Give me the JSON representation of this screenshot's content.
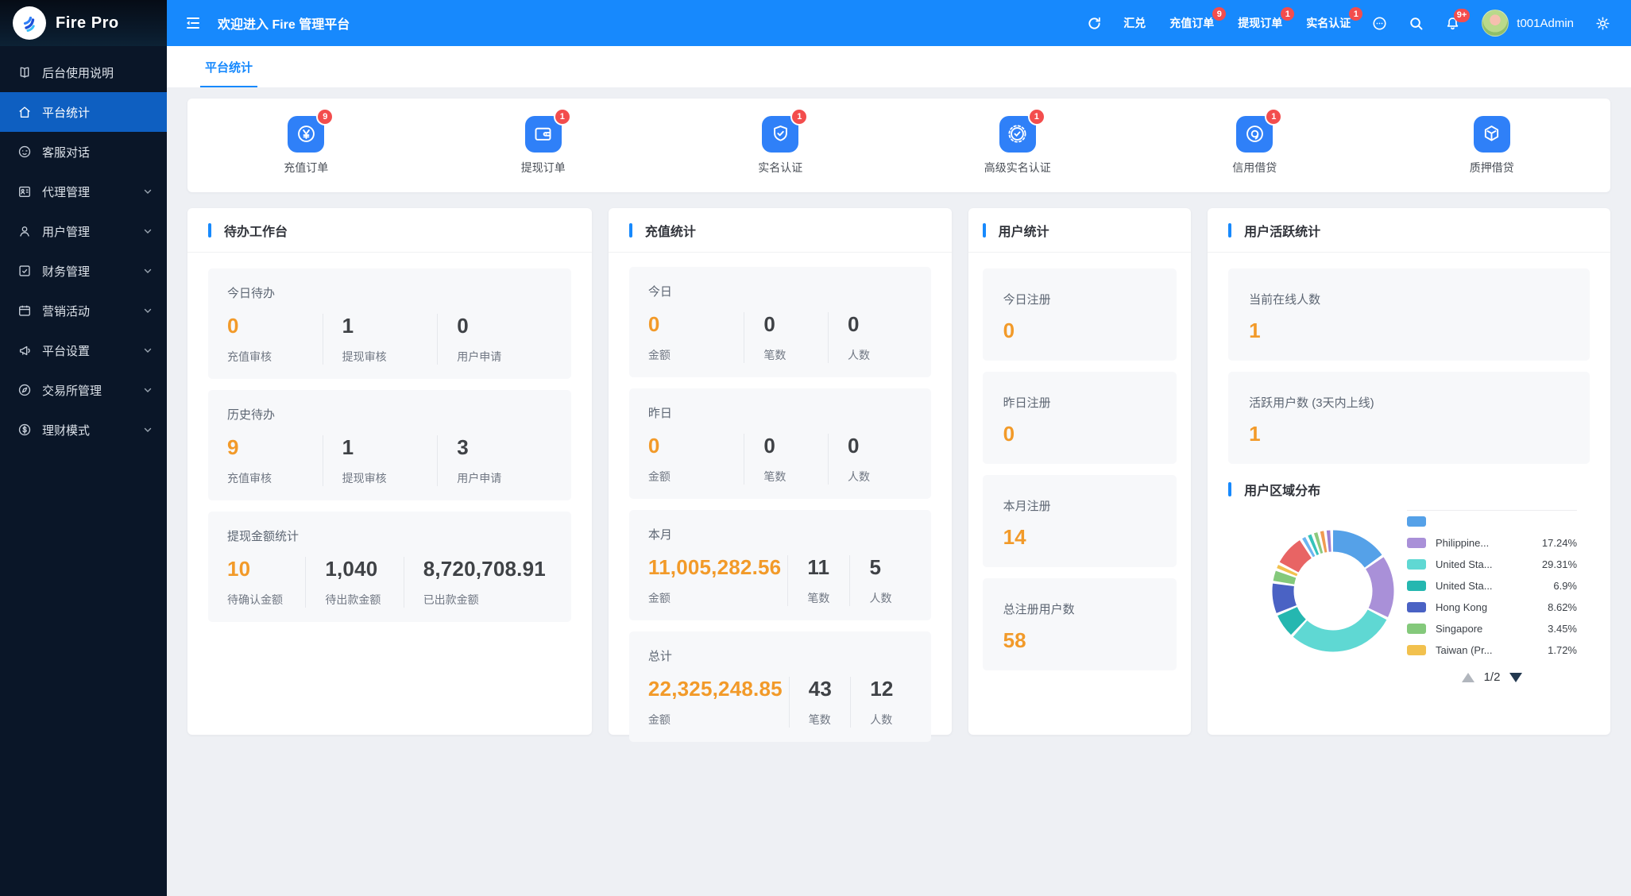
{
  "sidebar": {
    "logo_text": "Fire Pro",
    "items": [
      {
        "label": "后台使用说明",
        "icon": "manual-icon",
        "expandable": false,
        "active": false
      },
      {
        "label": "平台统计",
        "icon": "home-icon",
        "expandable": false,
        "active": true
      },
      {
        "label": "客服对话",
        "icon": "chat-service-icon",
        "expandable": false,
        "active": false
      },
      {
        "label": "代理管理",
        "icon": "agent-icon",
        "expandable": true,
        "active": false
      },
      {
        "label": "用户管理",
        "icon": "user-icon",
        "expandable": true,
        "active": false
      },
      {
        "label": "财务管理",
        "icon": "finance-icon",
        "expandable": true,
        "active": false
      },
      {
        "label": "营销活动",
        "icon": "calendar-icon",
        "expandable": true,
        "active": false
      },
      {
        "label": "平台设置",
        "icon": "megaphone-icon",
        "expandable": true,
        "active": false
      },
      {
        "label": "交易所管理",
        "icon": "compass-icon",
        "expandable": true,
        "active": false
      },
      {
        "label": "理财模式",
        "icon": "dollar-icon",
        "expandable": true,
        "active": false
      }
    ]
  },
  "header": {
    "welcome": "欢迎进入 Fire 管理平台",
    "links": [
      {
        "label": "汇兑",
        "badge": ""
      },
      {
        "label": "充值订单",
        "badge": "9"
      },
      {
        "label": "提现订单",
        "badge": "1"
      },
      {
        "label": "实名认证",
        "badge": "1"
      }
    ],
    "bell_badge": "9+",
    "username": "t001Admin"
  },
  "tabs": [
    {
      "label": "平台统计",
      "active": true
    }
  ],
  "quick_icons": [
    {
      "label": "充值订单",
      "badge": "9",
      "icon": "recharge-order-icon"
    },
    {
      "label": "提现订单",
      "badge": "1",
      "icon": "withdraw-order-icon"
    },
    {
      "label": "实名认证",
      "badge": "1",
      "icon": "kyc-icon"
    },
    {
      "label": "高级实名认证",
      "badge": "1",
      "icon": "advanced-kyc-icon"
    },
    {
      "label": "信用借贷",
      "badge": "1",
      "icon": "credit-loan-icon"
    },
    {
      "label": "质押借贷",
      "badge": "",
      "icon": "pledge-loan-icon"
    }
  ],
  "todo_card": {
    "title": "待办工作台",
    "sections": [
      {
        "title": "今日待办",
        "stats": [
          {
            "value": "0",
            "label": "充值审核",
            "accent": true
          },
          {
            "value": "1",
            "label": "提现审核",
            "accent": false
          },
          {
            "value": "0",
            "label": "用户申请",
            "accent": false
          }
        ]
      },
      {
        "title": "历史待办",
        "stats": [
          {
            "value": "9",
            "label": "充值审核",
            "accent": true
          },
          {
            "value": "1",
            "label": "提现审核",
            "accent": false
          },
          {
            "value": "3",
            "label": "用户申请",
            "accent": false
          }
        ]
      },
      {
        "title": "提现金额统计",
        "stats": [
          {
            "value": "10",
            "label": "待确认金额",
            "accent": true
          },
          {
            "value": "1,040",
            "label": "待出款金额",
            "accent": false
          },
          {
            "value": "8,720,708.91",
            "label": "已出款金额",
            "accent": false
          }
        ]
      }
    ]
  },
  "recharge_card": {
    "title": "充值统计",
    "sections": [
      {
        "title": "今日",
        "stats": [
          {
            "value": "0",
            "label": "金额",
            "accent": true
          },
          {
            "value": "0",
            "label": "笔数",
            "accent": false
          },
          {
            "value": "0",
            "label": "人数",
            "accent": false
          }
        ]
      },
      {
        "title": "昨日",
        "stats": [
          {
            "value": "0",
            "label": "金额",
            "accent": true
          },
          {
            "value": "0",
            "label": "笔数",
            "accent": false
          },
          {
            "value": "0",
            "label": "人数",
            "accent": false
          }
        ]
      },
      {
        "title": "本月",
        "stats": [
          {
            "value": "11,005,282.56",
            "label": "金额",
            "accent": true
          },
          {
            "value": "11",
            "label": "笔数",
            "accent": false
          },
          {
            "value": "5",
            "label": "人数",
            "accent": false
          }
        ]
      },
      {
        "title": "总计",
        "stats": [
          {
            "value": "22,325,248.85",
            "label": "金额",
            "accent": true
          },
          {
            "value": "43",
            "label": "笔数",
            "accent": false
          },
          {
            "value": "12",
            "label": "人数",
            "accent": false
          }
        ]
      }
    ]
  },
  "user_card": {
    "title": "用户统计",
    "sections": [
      {
        "label": "今日注册",
        "value": "0"
      },
      {
        "label": "昨日注册",
        "value": "0"
      },
      {
        "label": "本月注册",
        "value": "14"
      },
      {
        "label": "总注册用户数",
        "value": "58"
      }
    ]
  },
  "active_card": {
    "title": "用户活跃统计",
    "sections": [
      {
        "label": "当前在线人数",
        "value": "1"
      },
      {
        "label": "活跃用户数 (3天内上线)",
        "value": "1"
      }
    ],
    "region_title": "用户区域分布",
    "pagination": "1/2"
  },
  "chart_data": {
    "type": "pie",
    "title": "用户区域分布",
    "legend_position": "right",
    "legend_pagination": "1/2",
    "series": [
      {
        "name": "",
        "value": 15.6,
        "color": "#55a1e8"
      },
      {
        "name": "Philippine...",
        "value": 17.24,
        "color": "#a990d8"
      },
      {
        "name": "United Sta...",
        "value": 29.31,
        "color": "#5fd8d3"
      },
      {
        "name": "United Sta...",
        "value": 6.9,
        "color": "#25b7b0"
      },
      {
        "name": "Hong Kong",
        "value": 8.62,
        "color": "#4a62c4"
      },
      {
        "name": "Singapore",
        "value": 3.45,
        "color": "#84c97b"
      },
      {
        "name": "Taiwan (Pr...",
        "value": 1.72,
        "color": "#f2c14e"
      },
      {
        "name": "",
        "value": 8.62,
        "color": "#e86464"
      },
      {
        "name": "",
        "value": 1.7,
        "color": "#6db5f0"
      },
      {
        "name": "",
        "value": 1.7,
        "color": "#35c3bb"
      },
      {
        "name": "",
        "value": 1.7,
        "color": "#8bc97e"
      },
      {
        "name": "",
        "value": 1.7,
        "color": "#f09a52"
      },
      {
        "name": "",
        "value": 1.7,
        "color": "#9b7fd4"
      }
    ],
    "legend_visible_rows": [
      {
        "color": "#55a1e8",
        "label": "",
        "pct": ""
      },
      {
        "color": "#a990d8",
        "label": "Philippine...",
        "pct": "17.24%"
      },
      {
        "color": "#5fd8d3",
        "label": "United Sta...",
        "pct": "29.31%"
      },
      {
        "color": "#25b7b0",
        "label": "United Sta...",
        "pct": "6.9%"
      },
      {
        "color": "#4a62c4",
        "label": "Hong Kong",
        "pct": "8.62%"
      },
      {
        "color": "#84c97b",
        "label": "Singapore",
        "pct": "3.45%"
      },
      {
        "color": "#f2c14e",
        "label": "Taiwan (Pr...",
        "pct": "1.72%"
      },
      {
        "color": "#f06a6a",
        "label": "",
        "pct": ""
      }
    ]
  }
}
